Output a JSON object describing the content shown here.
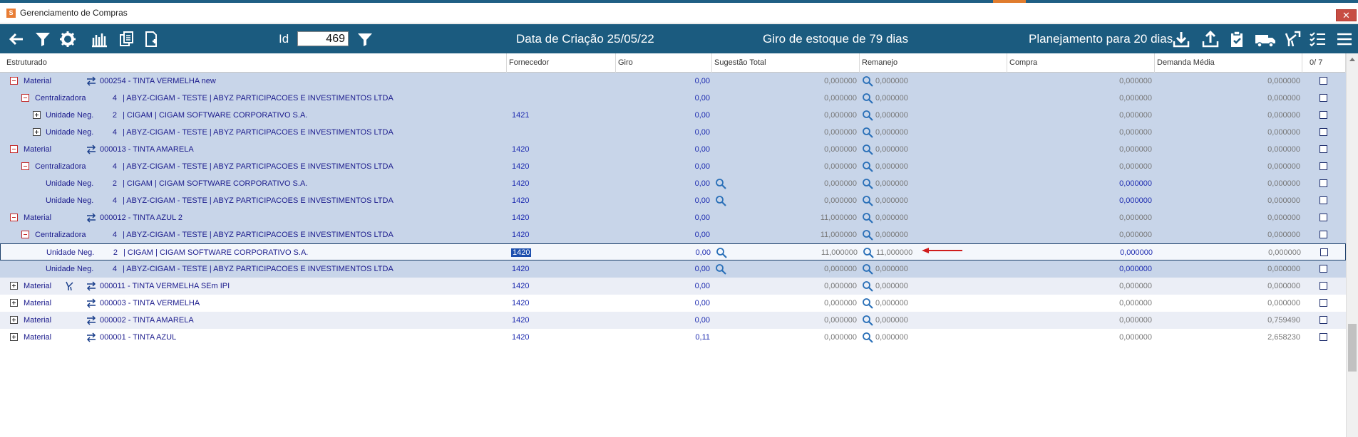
{
  "window": {
    "title": "Gerenciamento de Compras",
    "close_symbol": "✕"
  },
  "toolbar": {
    "id_label": "Id",
    "id_value": "469",
    "creation_date": "Data de Criação 25/05/22",
    "stock_turnover": "Giro de estoque de  79 dias",
    "planning": "Planejamento para 20 dias",
    "icons": [
      "back-arrow-icon",
      "filter-icon",
      "gear-icon",
      "bar-chart-icon",
      "copy-pages-icon",
      "new-page-icon",
      "filter-icon",
      "download-icon",
      "upload-icon",
      "clipboard-check-icon",
      "truck-icon",
      "fork-icon",
      "checklist-icon",
      "menu-icon"
    ]
  },
  "columns": {
    "estruturado": "Estruturado",
    "fornecedor": "Fornecedor",
    "giro": "Giro",
    "sugestao": "Sugestão Total",
    "remanejo": "Remanejo",
    "compra": "Compra",
    "demanda": "Demanda Média",
    "count": "0/  7"
  },
  "rows": [
    {
      "type": "Material",
      "id": "000254 - TINTA VERMELHA new",
      "fornecedor": "",
      "giro": "0,00",
      "sugestao": "0,000000",
      "remanejo": "0,000000",
      "compra": "0,000000",
      "demanda": "0,000000"
    },
    {
      "type": "Centralizadora",
      "num": "4",
      "id": "| ABYZ-CIGAM - TESTE | ABYZ PARTICIPACOES E INVESTIMENTOS LTDA",
      "fornecedor": "",
      "giro": "0,00",
      "sugestao": "0,000000",
      "remanejo": "0,000000",
      "compra": "0,000000",
      "demanda": "0,000000"
    },
    {
      "type": "Unidade Neg.",
      "num": "2",
      "id": "| CIGAM | CIGAM SOFTWARE CORPORATIVO S.A.",
      "fornecedor": "1421",
      "giro": "0,00",
      "sugestao": "0,000000",
      "remanejo": "0,000000",
      "compra": "0,000000",
      "demanda": "0,000000"
    },
    {
      "type": "Unidade Neg.",
      "num": "4",
      "id": "| ABYZ-CIGAM - TESTE | ABYZ PARTICIPACOES E INVESTIMENTOS LTDA",
      "fornecedor": "",
      "giro": "0,00",
      "sugestao": "0,000000",
      "remanejo": "0,000000",
      "compra": "0,000000",
      "demanda": "0,000000"
    },
    {
      "type": "Material",
      "id": "000013 - TINTA AMARELA",
      "fornecedor": "1420",
      "giro": "0,00",
      "sugestao": "0,000000",
      "remanejo": "0,000000",
      "compra": "0,000000",
      "demanda": "0,000000"
    },
    {
      "type": "Centralizadora",
      "num": "4",
      "id": "| ABYZ-CIGAM - TESTE | ABYZ PARTICIPACOES E INVESTIMENTOS LTDA",
      "fornecedor": "1420",
      "giro": "0,00",
      "sugestao": "0,000000",
      "remanejo": "0,000000",
      "compra": "0,000000",
      "demanda": "0,000000"
    },
    {
      "type": "Unidade Neg.",
      "num": "2",
      "id": "| CIGAM | CIGAM SOFTWARE CORPORATIVO S.A.",
      "fornecedor": "1420",
      "giro": "0,00",
      "sugestao": "0,000000",
      "remanejo": "0,000000",
      "compra": "0,000000",
      "demanda": "0,000000"
    },
    {
      "type": "Unidade Neg.",
      "num": "4",
      "id": "| ABYZ-CIGAM - TESTE | ABYZ PARTICIPACOES E INVESTIMENTOS LTDA",
      "fornecedor": "1420",
      "giro": "0,00",
      "sugestao": "0,000000",
      "remanejo": "0,000000",
      "compra": "0,000000",
      "demanda": "0,000000"
    },
    {
      "type": "Material",
      "id": "000012 - TINTA AZUL 2",
      "fornecedor": "1420",
      "giro": "0,00",
      "sugestao": "11,000000",
      "remanejo": "0,000000",
      "compra": "0,000000",
      "demanda": "0,000000"
    },
    {
      "type": "Centralizadora",
      "num": "4",
      "id": "| ABYZ-CIGAM - TESTE | ABYZ PARTICIPACOES E INVESTIMENTOS LTDA",
      "fornecedor": "1420",
      "giro": "0,00",
      "sugestao": "11,000000",
      "remanejo": "0,000000",
      "compra": "0,000000",
      "demanda": "0,000000"
    },
    {
      "type": "Unidade Neg.",
      "num": "2",
      "id": "| CIGAM | CIGAM SOFTWARE CORPORATIVO S.A.",
      "fornecedor": "1420",
      "giro": "0,00",
      "sugestao": "11,000000",
      "remanejo": "11,000000",
      "compra": "0,000000",
      "demanda": "0,000000"
    },
    {
      "type": "Unidade Neg.",
      "num": "4",
      "id": "| ABYZ-CIGAM - TESTE | ABYZ PARTICIPACOES E INVESTIMENTOS LTDA",
      "fornecedor": "1420",
      "giro": "0,00",
      "sugestao": "0,000000",
      "remanejo": "0,000000",
      "compra": "0,000000",
      "demanda": "0,000000"
    },
    {
      "type": "Material",
      "id": "000011 - TINTA VERMELHA SEm IPI",
      "fornecedor": "1420",
      "giro": "0,00",
      "sugestao": "0,000000",
      "remanejo": "0,000000",
      "compra": "0,000000",
      "demanda": "0,000000"
    },
    {
      "type": "Material",
      "id": "000003 - TINTA VERMELHA",
      "fornecedor": "1420",
      "giro": "0,00",
      "sugestao": "0,000000",
      "remanejo": "0,000000",
      "compra": "0,000000",
      "demanda": "0,000000"
    },
    {
      "type": "Material",
      "id": "000002 - TINTA AMARELA",
      "fornecedor": "1420",
      "giro": "0,00",
      "sugestao": "0,000000",
      "remanejo": "0,000000",
      "compra": "0,000000",
      "demanda": "0,759490"
    },
    {
      "type": "Material",
      "id": "000001 - TINTA AZUL",
      "fornecedor": "1420",
      "giro": "0,11",
      "sugestao": "0,000000",
      "remanejo": "0,000000",
      "compra": "0,000000",
      "demanda": "2,658230"
    }
  ],
  "colors": {
    "toolbar_bg": "#1b5b7f",
    "row_expanded": "#c8d5e9",
    "row_alt": "#ebeef6",
    "text_blue": "#1a1a8c",
    "arrow_red": "#d01c1c"
  }
}
